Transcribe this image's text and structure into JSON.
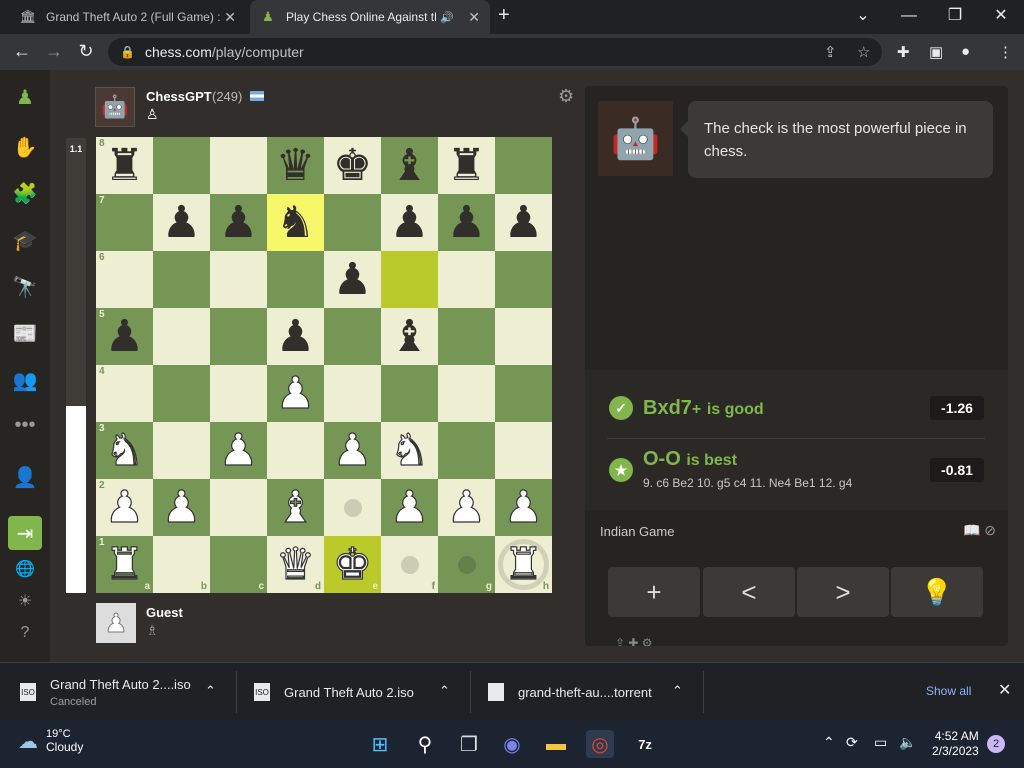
{
  "browser": {
    "tabs": [
      {
        "title": "Grand Theft Auto 2 (Full Game) :",
        "icon": "archive-icon"
      },
      {
        "title": "Play Chess Online Against th",
        "icon": "chess-pawn-icon",
        "audio": true,
        "active": true
      }
    ],
    "url_domain": "chess.com",
    "url_path": "/play/computer"
  },
  "opponent": {
    "name": "ChessGPT",
    "rating": "(249)",
    "flag": "argentina-flag"
  },
  "player": {
    "name": "Guest"
  },
  "eval": {
    "score": "1.1",
    "white_fraction": 0.41
  },
  "board": {
    "colors": {
      "light": "#eeeed2",
      "dark": "#769656",
      "highlight_from": "#f7f769",
      "highlight_to": "#baca2b"
    },
    "ranks": [
      "8",
      "7",
      "6",
      "5",
      "4",
      "3",
      "2",
      "1"
    ],
    "files": [
      "a",
      "b",
      "c",
      "d",
      "e",
      "f",
      "g",
      "h"
    ],
    "position": [
      [
        "r",
        "",
        "",
        "q",
        "k",
        "b",
        "r",
        ""
      ],
      [
        "",
        "p",
        "p",
        "n",
        "",
        "p",
        "p",
        "p"
      ],
      [
        "",
        "",
        "",
        "",
        "p",
        "",
        "",
        ""
      ],
      [
        "p",
        "",
        "",
        "p",
        "",
        "b",
        "",
        ""
      ],
      [
        "",
        "",
        "",
        "P",
        "",
        "",
        "",
        ""
      ],
      [
        "N",
        "",
        "P",
        "",
        "P",
        "N",
        "",
        ""
      ],
      [
        "P",
        "P",
        "",
        "B",
        "",
        "P",
        "P",
        "P"
      ],
      [
        "R",
        "",
        "",
        "Q",
        "K",
        "",
        "",
        "R"
      ]
    ],
    "highlight_from": "d7",
    "highlight_to": "f6",
    "selected": "e1",
    "move_dots": [
      "e2",
      "f1",
      "g1"
    ],
    "capture_rings": [
      "h1"
    ]
  },
  "coach": {
    "message": "The check is the most powerful piece in chess."
  },
  "feedback": {
    "good": {
      "move": "Bxd7",
      "suffix": "+",
      "label": "is good",
      "score": "-1.26"
    },
    "best": {
      "move": "O-O",
      "label": "is best",
      "score": "-0.81",
      "line": "9. c6 Be2 10. g5 c4 11. Ne4 Be1 12. g4"
    }
  },
  "opening": {
    "name": "Indian Game"
  },
  "controls": [
    {
      "name": "new-game",
      "glyph": "+"
    },
    {
      "name": "back",
      "glyph": "<"
    },
    {
      "name": "forward",
      "glyph": ">"
    },
    {
      "name": "hint",
      "glyph": "💡"
    }
  ],
  "downloads": [
    {
      "name": "Grand Theft Auto 2....iso",
      "status": "Canceled",
      "icon": "iso-file-icon"
    },
    {
      "name": "Grand Theft Auto 2.iso",
      "status": "",
      "icon": "iso-file-icon"
    },
    {
      "name": "grand-theft-au....torrent",
      "status": "",
      "icon": "file-icon"
    }
  ],
  "show_all_label": "Show all",
  "taskbar": {
    "weather_temp": "19°C",
    "weather_cond": "Cloudy",
    "time": "4:52 AM",
    "date": "2/3/2023",
    "notifications": "2"
  }
}
